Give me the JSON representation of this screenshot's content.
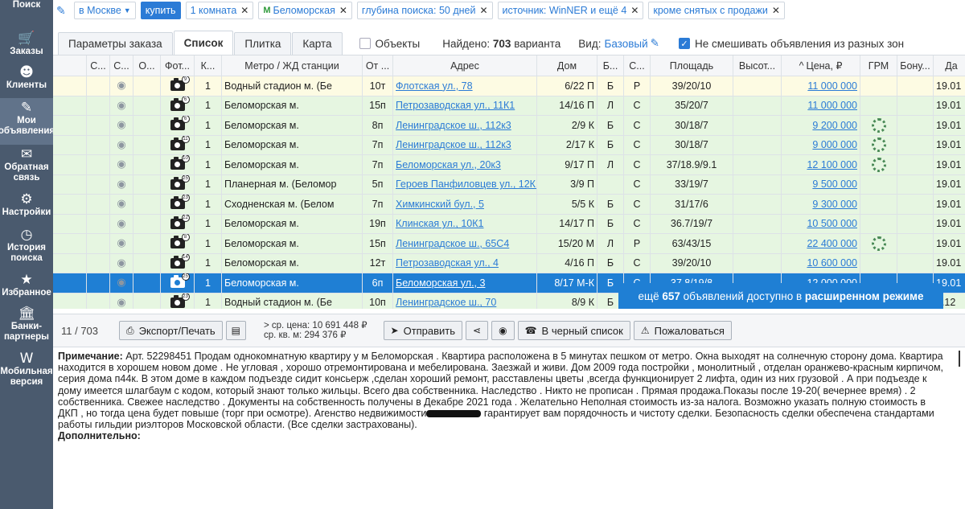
{
  "sidebar": {
    "items": [
      {
        "label": "Поиск",
        "icon": "search-icon"
      },
      {
        "label": "Заказы",
        "icon": "cart-icon"
      },
      {
        "label": "Клиенты",
        "icon": "face-icon"
      },
      {
        "label": "Мои\nобъявления",
        "icon": "pencil-icon"
      },
      {
        "label": "Обратная\nсвязь",
        "icon": "feedback-icon"
      },
      {
        "label": "Настройки",
        "icon": "gear-icon"
      },
      {
        "label": "История\nпоиска",
        "icon": "history-icon"
      },
      {
        "label": "Избранное",
        "icon": "star-icon"
      },
      {
        "label": "Банки-\nпартнеры",
        "icon": "bank-icon"
      },
      {
        "label": "Мобильная\nверсия",
        "icon": "mobile-icon"
      }
    ]
  },
  "filters": {
    "city": "в Москве",
    "deal": "купить",
    "rooms": "1 комната",
    "metro": "Беломорская",
    "depth": "глубина поиска: 50 дней",
    "source": "источник: WinNER и ещё 4",
    "exclude": "кроме снятых с продажи",
    "metro_symbol": "M"
  },
  "tabs": {
    "order_params": "Параметры заказа",
    "list": "Список",
    "tile": "Плитка",
    "map": "Карта",
    "objects": "Объекты",
    "found_prefix": "Найдено:",
    "found_count": "703",
    "found_suffix": "варианта",
    "view_label": "Вид:",
    "view_value": "Базовый",
    "no_mix": "Не смешивать объявления из разных зон"
  },
  "table": {
    "headers": [
      "С...",
      "С...",
      "О...",
      "Фот...",
      "К...",
      "Метро / ЖД станции",
      "От ...",
      "Адрес",
      "Дом",
      "Б...",
      "С...",
      "Площадь",
      "Высот...",
      "Цена, ₽",
      "ГРМ",
      "Бону...",
      "Да"
    ],
    "rows": [
      {
        "photos": "9",
        "rooms": "1",
        "metro": "Водный стадион м. (Бе",
        "dist": "10т",
        "address": "Флотская ул., 78",
        "house": "6/22 П",
        "b": "Б",
        "s": "Р",
        "area": "39/20/10",
        "price": "11 000 000",
        "grm": false,
        "date": "19.01",
        "style": "yellow"
      },
      {
        "photos": "6",
        "rooms": "1",
        "metro": "Беломорская м.",
        "dist": "15п",
        "address": "Петрозаводская ул., 11К1",
        "house": "14/16 П",
        "b": "Л",
        "s": "С",
        "area": "35/20/7",
        "price": "11 000 000",
        "grm": false,
        "date": "19.01",
        "style": "green"
      },
      {
        "photos": "6",
        "rooms": "1",
        "metro": "Беломорская м.",
        "dist": "8п",
        "address": "Ленинградское ш., 112к3",
        "house": "2/9 К",
        "b": "Б",
        "s": "С",
        "area": "30/18/7",
        "price": "9 200 000",
        "grm": true,
        "date": "19.01",
        "style": "green"
      },
      {
        "photos": "11",
        "rooms": "1",
        "metro": "Беломорская м.",
        "dist": "7п",
        "address": "Ленинградское ш., 112к3",
        "house": "2/17 К",
        "b": "Б",
        "s": "С",
        "area": "30/18/7",
        "price": "9 000 000",
        "grm": true,
        "date": "19.01",
        "style": "green"
      },
      {
        "photos": "10",
        "rooms": "1",
        "metro": "Беломорская м.",
        "dist": "7п",
        "address": "Беломорская ул., 20к3",
        "house": "9/17 П",
        "b": "Л",
        "s": "С",
        "area": "37/18.9/9.1",
        "price": "12 100 000",
        "grm": true,
        "date": "19.01",
        "style": "green"
      },
      {
        "photos": "25",
        "rooms": "1",
        "metro": "Планерная м. (Беломор",
        "dist": "5п",
        "address": "Героев Панфиловцев ул., 12К1",
        "house": "3/9 П",
        "b": "",
        "s": "С",
        "area": "33/19/7",
        "price": "9 500 000",
        "grm": false,
        "date": "19.01",
        "style": "green"
      },
      {
        "photos": "23",
        "rooms": "1",
        "metro": "Сходненская м. (Белом",
        "dist": "7п",
        "address": "Химкинский бул., 5",
        "house": "5/5 К",
        "b": "Б",
        "s": "С",
        "area": "31/17/6",
        "price": "9 300 000",
        "grm": false,
        "date": "19.01",
        "style": "green"
      },
      {
        "photos": "22",
        "rooms": "1",
        "metro": "Беломорская м.",
        "dist": "19п",
        "address": "Клинская ул., 10К1",
        "house": "14/17 П",
        "b": "Б",
        "s": "С",
        "area": "36.7/19/7",
        "price": "10 500 000",
        "grm": false,
        "date": "19.01",
        "style": "green"
      },
      {
        "photos": "8",
        "rooms": "1",
        "metro": "Беломорская м.",
        "dist": "15п",
        "address": "Ленинградское ш., 65С4",
        "house": "15/20 М",
        "b": "Л",
        "s": "Р",
        "area": "63/43/15",
        "price": "22 400 000",
        "grm": true,
        "date": "19.01",
        "style": "green"
      },
      {
        "photos": "14",
        "rooms": "1",
        "metro": "Беломорская м.",
        "dist": "12т",
        "address": "Петрозаводская ул., 4",
        "house": "4/16 П",
        "b": "Б",
        "s": "С",
        "area": "39/20/10",
        "price": "10 600 000",
        "grm": false,
        "date": "19.01",
        "style": "green"
      },
      {
        "photos": "25",
        "rooms": "1",
        "metro": "Беломорская м.",
        "dist": "6п",
        "address": "Беломорская ул., 3",
        "house": "8/17 М-К",
        "b": "Б",
        "s": "С",
        "area": "37.8/19/8",
        "price": "12 000 000",
        "grm": false,
        "date": "19.01",
        "style": "selected"
      },
      {
        "photos": "23",
        "rooms": "1",
        "metro": "Водный стадион м. (Бе",
        "dist": "10п",
        "address": "Ленинградское ш., 70",
        "house": "8/9 К",
        "b": "Б",
        "s": "С",
        "area": "",
        "price": "",
        "grm": false,
        "date": "2.12",
        "style": "green"
      }
    ]
  },
  "promo": {
    "prefix": "ещё",
    "count": "657",
    "middle": "объявлений доступно в",
    "strong": "расширенном режиме"
  },
  "toolbar": {
    "counter": "11 / 703",
    "export": "Экспорт/Печать",
    "avg_price": "> ср. цена: 10 691 448 ₽",
    "avg_sqm": "ср. кв. м: 294 376 ₽",
    "send": "Отправить",
    "blacklist": "В черный список",
    "complain": "Пожаловаться"
  },
  "notes": {
    "label": "Примечание:",
    "text_before": "Арт. 52298451 Продам однокомнатную квартиру у м Беломорская . Квартира расположена в 5 минутах пешком от метро. Окна выходят на солнечную сторону дома. Квартира находится в хорошем новом доме . Не угловая , хорошо отремонтирована и мебелирована. Заезжай и живи. Дом 2009 года постройки , монолитный , отделан оранжево-красным кирпичом, серия дома п44к. В этом доме в каждом подъезде сидит консьерж ,сделан хороший ремонт, расставлены цветы ,всегда функционирует 2 лифта, один из них грузовой . А при подъезде к дому имеется шлагбаум с кодом, который знают только жильцы. Всего два собственника. Наследство . Никто не прописан . Прямая продажа.Показы после 19-20( вечернее время) . 2 собственника. Свежее наследство . Документы на собственность получены в Декабре 2021 года . Желательно Неполная стоимость из-за налога. Возможно указать полную стоимость в ДКП , но тогда цена будет повыше (торг при осмотре). Агенство недвижимости",
    "text_after": " гарантирует вам порядочность и чистоту сделки. Безопасность сделки обеспечена стандартами работы гильдии риэлторов Московской области. (Все сделки застрахованы).",
    "extra_label": "Дополнительно:"
  },
  "colors": {
    "sidebar": "#4a5a6e",
    "accent": "#2b7bd6",
    "row_green": "#e6f6e1",
    "row_yellow": "#fdfbe3",
    "row_selected": "#1f7fd4"
  }
}
